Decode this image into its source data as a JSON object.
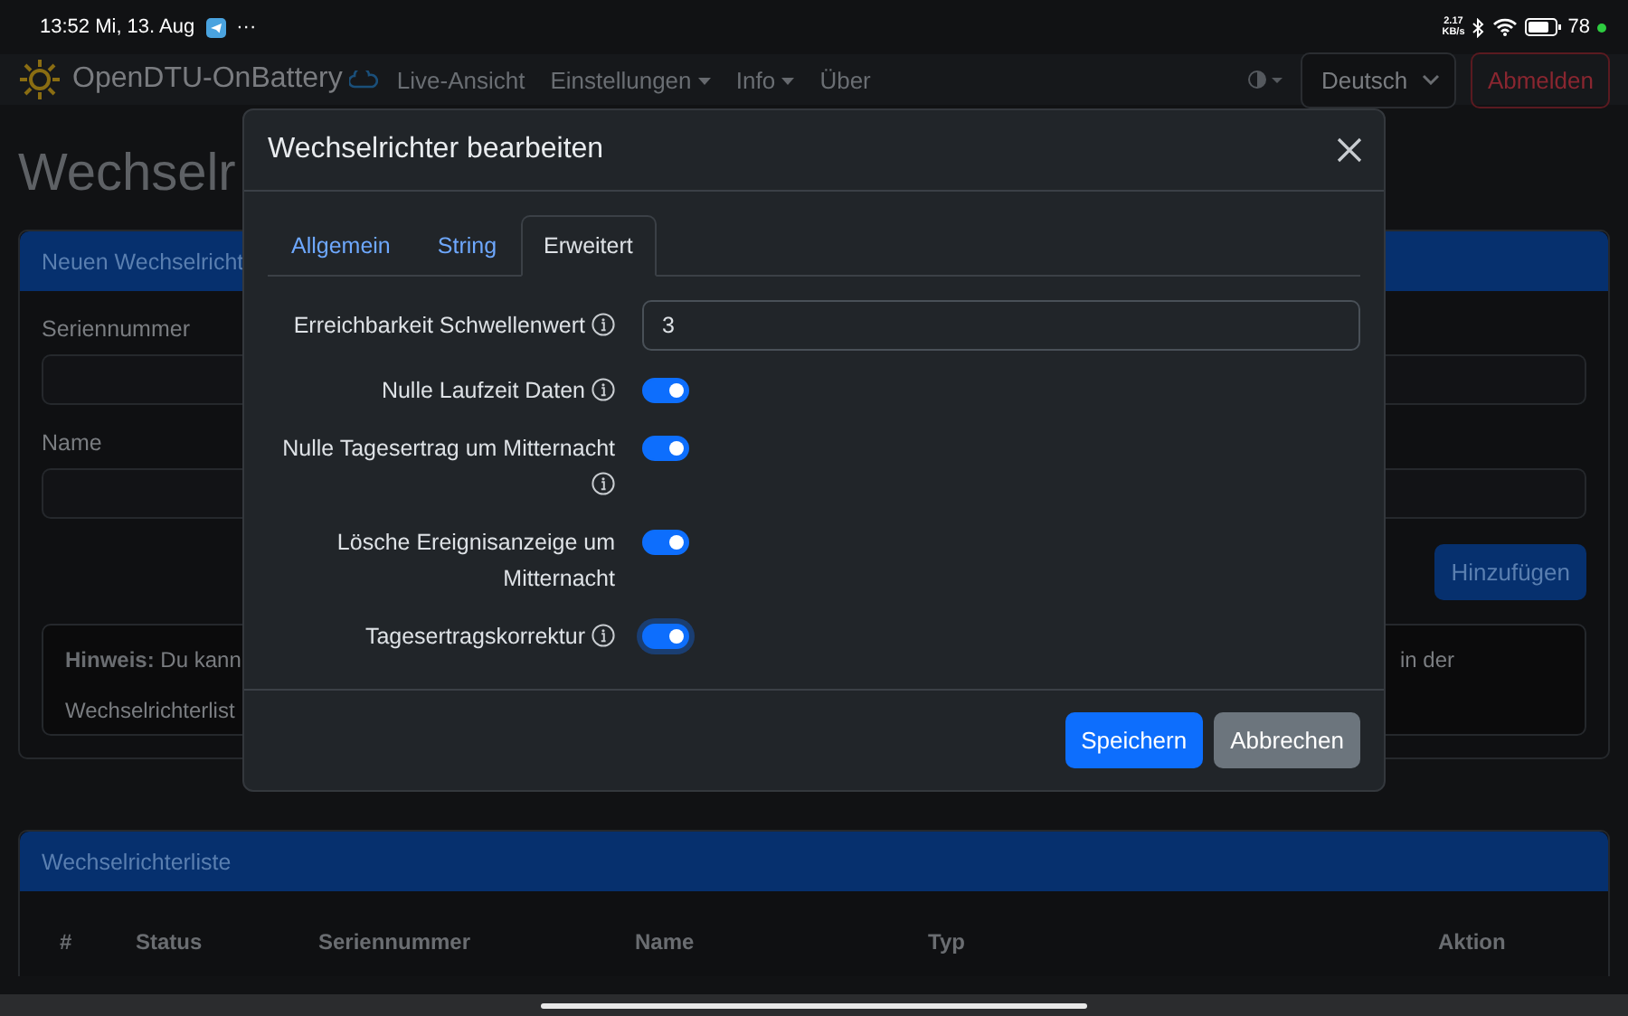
{
  "status_bar": {
    "time": "13:52 Mi, 13. Aug",
    "more": "···",
    "net_speed": "2.17",
    "net_unit": "KB/s",
    "battery": "78"
  },
  "navbar": {
    "brand": "OpenDTU-OnBattery",
    "links": [
      {
        "label": "Live-Ansicht",
        "dropdown": false
      },
      {
        "label": "Einstellungen",
        "dropdown": true
      },
      {
        "label": "Info",
        "dropdown": true
      },
      {
        "label": "Über",
        "dropdown": false
      }
    ],
    "language": "Deutsch",
    "logout": "Abmelden"
  },
  "page_title": "Wechselr",
  "add_card": {
    "title": "Neuen Wechselricht",
    "fields": [
      {
        "label": "Seriennummer"
      },
      {
        "label": "Name"
      }
    ],
    "add_button": "Hinzufügen",
    "hint_left": "**Hinweis:** Du kann",
    "hint_right": "in der",
    "hint_line2": "Wechselrichterlist"
  },
  "list_card": {
    "title": "Wechselrichterliste",
    "columns": [
      "#",
      "Status",
      "Seriennummer",
      "Name",
      "Typ",
      "Aktion"
    ]
  },
  "dialog": {
    "title": "Wechselrichter bearbeiten",
    "tabs": [
      {
        "label": "Allgemein",
        "selected": false
      },
      {
        "label": "String",
        "selected": false
      },
      {
        "label": "Erweitert",
        "selected": true
      }
    ],
    "rows": [
      {
        "kind": "input",
        "label": "Erreichbarkeit Schwellenwert",
        "info": true,
        "value": "3"
      },
      {
        "kind": "switch",
        "label": "Nulle Laufzeit Daten",
        "info": true,
        "on": true,
        "focused": false
      },
      {
        "kind": "switch",
        "label": "Nulle Tagesertrag um Mitternacht",
        "info": true,
        "on": true,
        "focused": false
      },
      {
        "kind": "switch",
        "label": "Lösche Ereignisanzeige um Mitternacht",
        "info": false,
        "on": true,
        "focused": false
      },
      {
        "kind": "switch",
        "label": "Tagesertragskorrektur",
        "info": true,
        "on": true,
        "focused": true
      }
    ],
    "buttons": [
      {
        "label": "Speichern",
        "kind": "primary"
      },
      {
        "label": "Abbrechen",
        "kind": "secondary"
      }
    ]
  }
}
